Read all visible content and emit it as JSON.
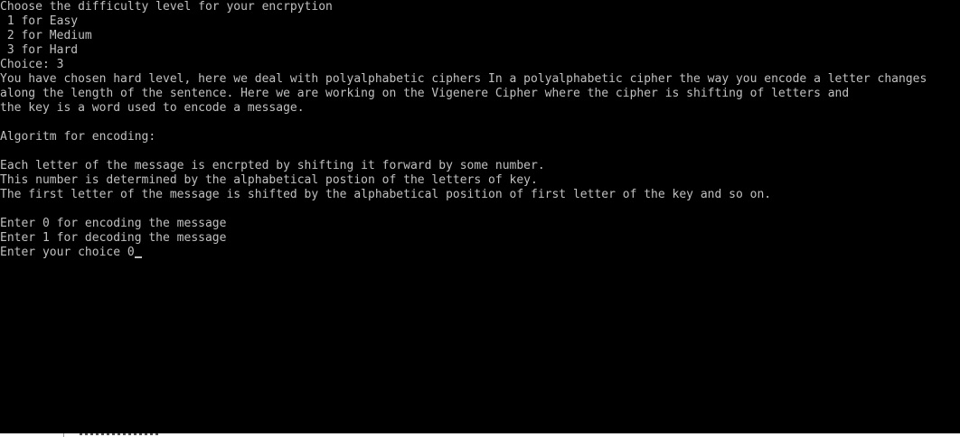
{
  "console": {
    "text_color": "#c0c0c0",
    "background": "#000000",
    "lines": [
      "Choose the difficulty level for your encrpytion",
      " 1 for Easy",
      " 2 for Medium",
      " 3 for Hard",
      "Choice: 3",
      "You have chosen hard level, here we deal with polyalphabetic ciphers In a polyalphabetic cipher the way you encode a letter changes",
      "along the length of the sentence. Here we are working on the Vigenere Cipher where the cipher is shifting of letters and",
      "the key is a word used to encode a message.",
      "",
      "Algoritm for encoding:",
      "",
      "Each letter of the message is encrpted by shifting it forward by some number.",
      "This number is determined by the alphabetical postion of the letters of key.",
      "The first letter of the message is shifted by the alphabetical position of first letter of the key and so on.",
      "",
      "Enter 0 for encoding the message",
      "Enter 1 for decoding the message"
    ],
    "prompt": "Enter your choice ",
    "input_value": "0"
  }
}
